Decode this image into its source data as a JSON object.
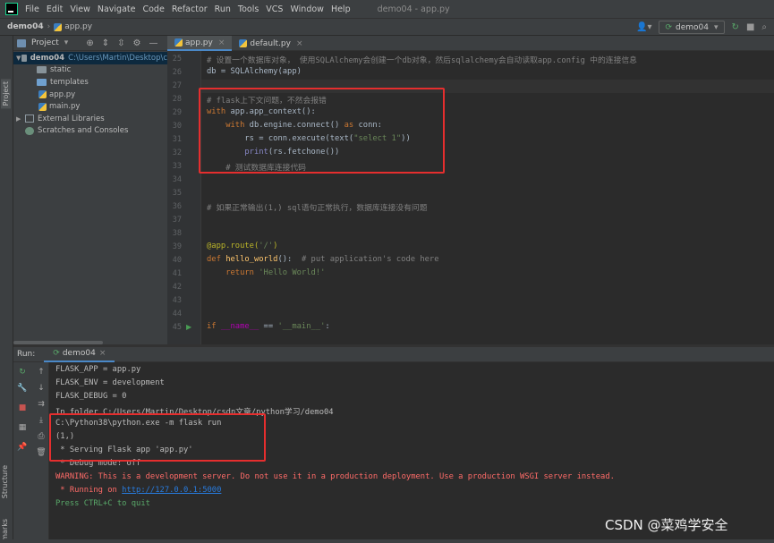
{
  "menu": [
    "File",
    "Edit",
    "View",
    "Navigate",
    "Code",
    "Refactor",
    "Run",
    "Tools",
    "VCS",
    "Window",
    "Help"
  ],
  "window_title": "demo04 - app.py",
  "breadcrumb": {
    "project": "demo04",
    "file": "app.py"
  },
  "run_config": "demo04",
  "side_tabs": {
    "project": "Project",
    "structure": "Structure",
    "bookmarks": "Bookmarks"
  },
  "project_panel": {
    "title": "Project",
    "tree": [
      {
        "label": "demo04",
        "path": "C:\\Users\\Martin\\Desktop\\c",
        "type": "root"
      },
      {
        "label": "static",
        "type": "folder"
      },
      {
        "label": "templates",
        "type": "folder"
      },
      {
        "label": "app.py",
        "type": "file"
      },
      {
        "label": "main.py",
        "type": "file"
      },
      {
        "label": "External Libraries",
        "type": "lib"
      },
      {
        "label": "Scratches and Consoles",
        "type": "scratch"
      }
    ]
  },
  "editor_tabs": [
    {
      "label": "app.py",
      "active": true
    },
    {
      "label": "default.py",
      "active": false
    }
  ],
  "code_lines": [
    {
      "num": "25",
      "html": "<span class=\"cmt\"># 设置一个数据库对象， 使用SQLAlchemy会创建一个db对象，然后sqlalchemy会自动读取app.config 中的连接信息</span>"
    },
    {
      "num": "26",
      "html": "db = SQLAlchemy(app)"
    },
    {
      "num": "27",
      "html": ""
    },
    {
      "num": "28",
      "html": "<span class=\"cmt\"># flask上下文问题，不然会报错</span>"
    },
    {
      "num": "29",
      "html": "<span class=\"kw\">with</span> app.app_context():"
    },
    {
      "num": "30",
      "html": "    <span class=\"kw\">with</span> db.engine.connect() <span class=\"kw\">as</span> conn:"
    },
    {
      "num": "31",
      "html": "        rs = conn.execute(text(<span class=\"str\">\"select 1\"</span>))"
    },
    {
      "num": "32",
      "html": "        <span class=\"bi\">print</span>(rs.fetchone())"
    },
    {
      "num": "33",
      "html": "    <span class=\"cmt\"># 测试数据库连接代码</span>"
    },
    {
      "num": "34",
      "html": ""
    },
    {
      "num": "35",
      "html": ""
    },
    {
      "num": "36",
      "html": "<span class=\"cmt\"># 如果正常输出(1,) sql语句正常执行，数据库连接没有问题</span>"
    },
    {
      "num": "37",
      "html": ""
    },
    {
      "num": "38",
      "html": ""
    },
    {
      "num": "39",
      "html": "<span class=\"deco\">@app.route(</span><span class=\"str\">'/'</span><span class=\"deco\">)</span>"
    },
    {
      "num": "40",
      "html": "<span class=\"kw\">def</span> <span class=\"fn\">hello_world</span>():  <span class=\"cmt\"># put application's code here</span>"
    },
    {
      "num": "41",
      "html": "    <span class=\"kw\">return</span> <span class=\"str\">'Hello World!'</span>"
    },
    {
      "num": "42",
      "html": ""
    },
    {
      "num": "43",
      "html": ""
    },
    {
      "num": "44",
      "html": ""
    },
    {
      "num": "45",
      "html": "<span class=\"kw\">if</span> <span class=\"dunder\">__name__</span> == <span class=\"str\">'__main__'</span>:"
    }
  ],
  "run_panel": {
    "label": "Run:",
    "tab": "demo04"
  },
  "console_lines": [
    {
      "text": "FLASK_APP = app.py",
      "style": ""
    },
    {
      "text": "FLASK_ENV = development",
      "style": ""
    },
    {
      "text": "FLASK_DEBUG = 0",
      "style": ""
    },
    {
      "text": "In folder C:/Users/Martin/Desktop/csdn文章/python学习/demo04",
      "style": ""
    },
    {
      "text": "C:\\Python38\\python.exe -m flask run",
      "style": ""
    },
    {
      "text": "(1,)",
      "style": ""
    },
    {
      "text": " * Serving Flask app 'app.py'",
      "style": ""
    },
    {
      "text": " * Debug mode: off",
      "style": ""
    },
    {
      "text": "WARNING: This is a development server. Do not use it in a production deployment. Use a production WSGI server instead.",
      "style": "err"
    },
    {
      "text": " * Running on ",
      "style": "err",
      "link": "http://127.0.0.1:5000"
    },
    {
      "text": "Press CTRL+C to quit",
      "style": "ok"
    }
  ],
  "watermark": "CSDN @菜鸡学安全"
}
